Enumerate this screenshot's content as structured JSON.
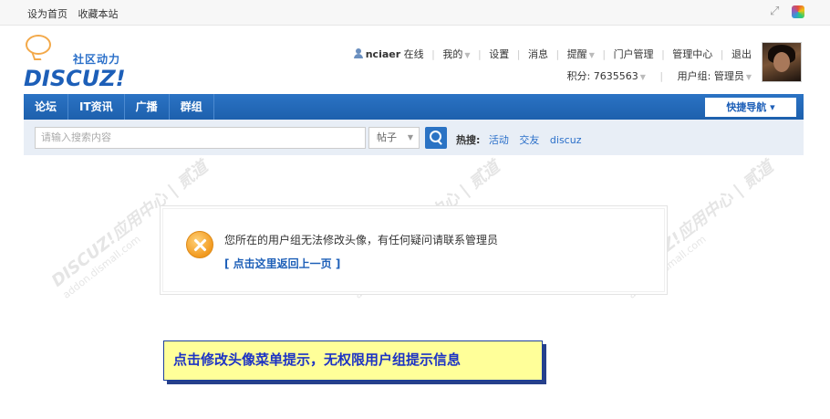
{
  "topbar": {
    "links": [
      "设为首页",
      "收藏本站"
    ],
    "icons": [
      "expand-icon",
      "color-palette-icon"
    ]
  },
  "logo": {
    "cn_text": "社区动力",
    "en_text": "DISCUZ!"
  },
  "user_nav": {
    "username": "nciaer",
    "status": "在线",
    "items": [
      "我的",
      "设置",
      "消息",
      "提醒",
      "门户管理",
      "管理中心",
      "退出"
    ]
  },
  "user_stat": {
    "credits": "积分: 7635563",
    "group": "用户组: 管理员"
  },
  "main_nav": {
    "items": [
      "论坛",
      "IT资讯",
      "广播",
      "群组"
    ],
    "quick_nav": "快捷导航"
  },
  "search": {
    "placeholder": "请输入搜索内容",
    "type": "帖子",
    "hot_label": "热搜:",
    "hot_words": [
      "活动",
      "交友",
      "discuz"
    ]
  },
  "message": {
    "text": "您所在的用户组无法修改头像，有任何疑问请联系管理员",
    "link": "[ 点击这里返回上一页 ]"
  },
  "watermark": {
    "text": "DISCUZ!应用中心 | 贰道",
    "sub": "addon.dismall.com"
  },
  "callout": {
    "text": "点击修改头像菜单提示，无权限用户组提示信息"
  }
}
